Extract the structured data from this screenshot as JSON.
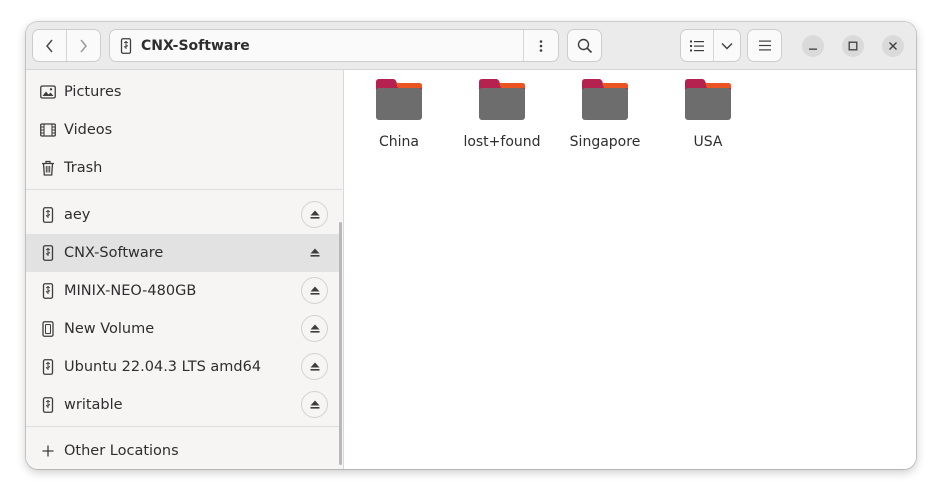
{
  "window": {
    "title": "CNX-Software"
  },
  "header": {
    "path_label": "CNX-Software",
    "nav_back_icon": "chevron-left-icon",
    "nav_forward_icon": "chevron-right-icon",
    "path_menu_icon": "vertical-dots-icon",
    "search_icon": "search-icon",
    "view_icon": "list-view-icon",
    "view_options_icon": "chevron-down-icon",
    "main_menu_icon": "hamburger-menu-icon",
    "window_controls": [
      "minimize-icon",
      "maximize-icon",
      "close-icon"
    ]
  },
  "sidebar": {
    "places": [
      {
        "label": "Pictures",
        "icon": "pictures-icon"
      },
      {
        "label": "Videos",
        "icon": "videos-icon"
      },
      {
        "label": "Trash",
        "icon": "trash-icon"
      }
    ],
    "devices": [
      {
        "label": "aey",
        "icon": "usb-drive-icon",
        "selected": false
      },
      {
        "label": "CNX-Software",
        "icon": "usb-drive-icon",
        "selected": true
      },
      {
        "label": "MINIX-NEO-480GB",
        "icon": "usb-drive-icon",
        "selected": false
      },
      {
        "label": "New Volume",
        "icon": "drive-icon",
        "selected": false
      },
      {
        "label": "Ubuntu 22.04.3 LTS amd64",
        "icon": "usb-drive-icon",
        "selected": false
      },
      {
        "label": "writable",
        "icon": "usb-drive-icon",
        "selected": false
      }
    ],
    "other_locations": {
      "label": "Other Locations",
      "icon": "plus-icon"
    }
  },
  "content": {
    "folders": [
      {
        "name": "China"
      },
      {
        "name": "lost+found"
      },
      {
        "name": "Singapore"
      },
      {
        "name": "USA"
      }
    ]
  },
  "colors": {
    "folder_tab": "#b5224f",
    "folder_tab_accent": "#e95420",
    "folder_body": "#6d6d6d",
    "selected_row": "#e2e2e2"
  }
}
